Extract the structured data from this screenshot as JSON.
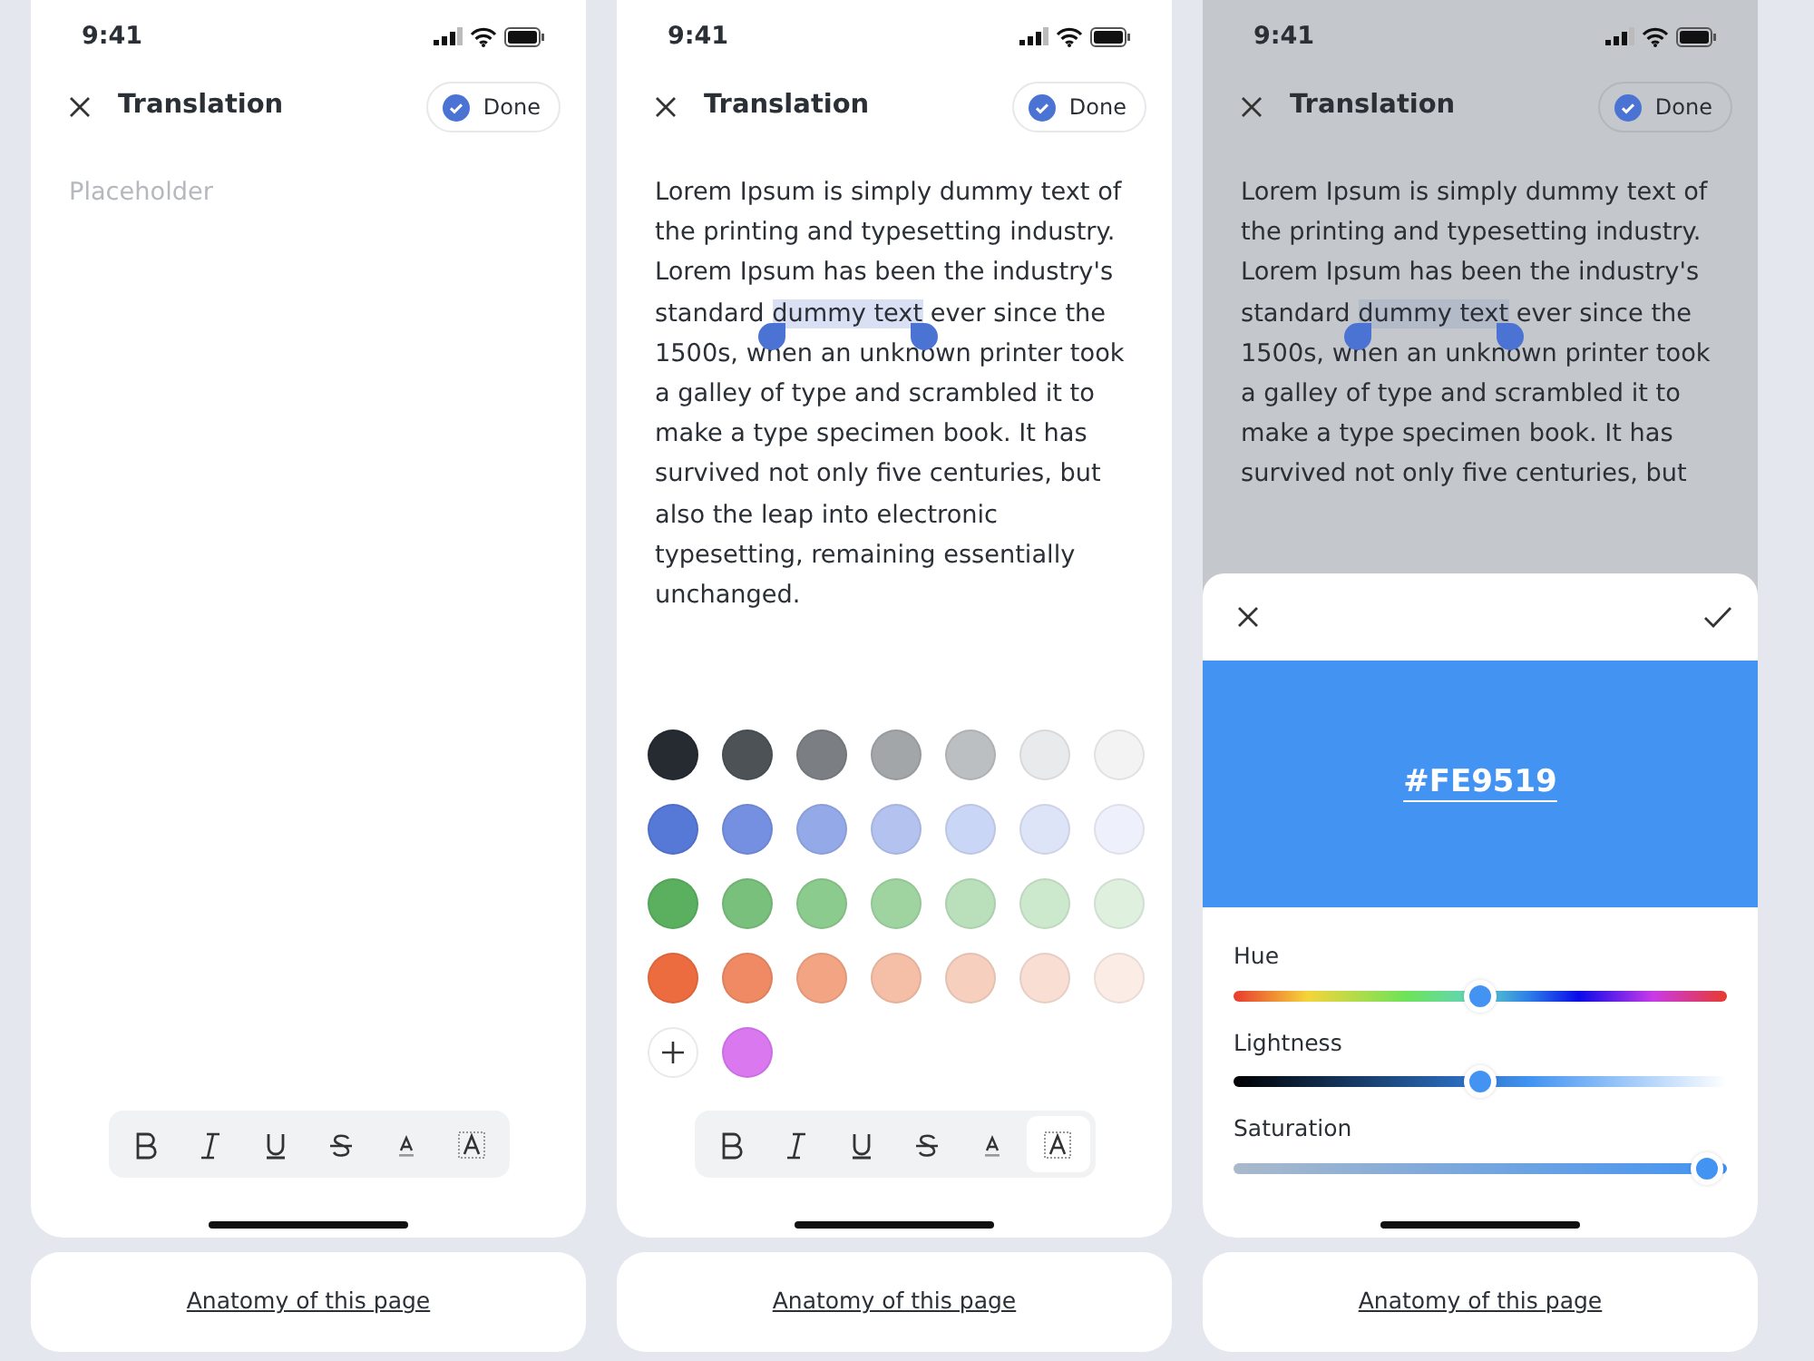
{
  "screens": [
    {
      "status_time": "9:41",
      "title": "Translation",
      "done_label": "Done",
      "dimmed": false,
      "editor": {
        "placeholder": "Placeholder"
      },
      "toolbar": [
        {
          "kind": "bold",
          "selected": false
        },
        {
          "kind": "italic",
          "selected": false
        },
        {
          "kind": "underline",
          "selected": false
        },
        {
          "kind": "strike",
          "selected": false
        },
        {
          "kind": "text-color",
          "selected": false
        },
        {
          "kind": "highlight",
          "selected": false
        }
      ],
      "footer_link": "Anatomy of this page"
    },
    {
      "status_time": "9:41",
      "title": "Translation",
      "done_label": "Done",
      "dimmed": false,
      "editor": {
        "text_before": "Lorem Ipsum is simply dummy text of the printing and typesetting industry. Lorem Ipsum has been the industry's standard ",
        "selection": "dummy text",
        "text_after": " ever since the 1500s, when an unknown printer took a galley of type and scrambled it to make a type specimen book. It has survived not only five centuries, but also the leap into electronic typesetting, remaining essentially unchanged."
      },
      "palette": {
        "colors": [
          {
            "color": "#262b31"
          },
          {
            "color": "#4d5257"
          },
          {
            "color": "#7b7f83"
          },
          {
            "color": "#a3a6a9"
          },
          {
            "color": "#bcbfc2"
          },
          {
            "color": "#e9eaeb"
          },
          {
            "color": "#f3f3f3"
          },
          {
            "color": "#5678d6"
          },
          {
            "color": "#7590e0"
          },
          {
            "color": "#94a9e8"
          },
          {
            "color": "#b3c2ef"
          },
          {
            "color": "#cad6f5"
          },
          {
            "color": "#dde4f8"
          },
          {
            "color": "#eef1fb"
          },
          {
            "color": "#5ab05f"
          },
          {
            "color": "#79c07c"
          },
          {
            "color": "#8ccb8e"
          },
          {
            "color": "#9fd4a1"
          },
          {
            "color": "#badfbb"
          },
          {
            "color": "#cde9cd"
          },
          {
            "color": "#dff0df"
          },
          {
            "color": "#ec6c3f"
          },
          {
            "color": "#ef8a64"
          },
          {
            "color": "#f2a483"
          },
          {
            "color": "#f5bea6"
          },
          {
            "color": "#f7cfbf"
          },
          {
            "color": "#f9ded3"
          },
          {
            "color": "#fbece6"
          }
        ],
        "custom_colors": [
          {
            "color": "#da78f0"
          }
        ]
      },
      "toolbar": [
        {
          "kind": "bold",
          "selected": false
        },
        {
          "kind": "italic",
          "selected": false
        },
        {
          "kind": "underline",
          "selected": false
        },
        {
          "kind": "strike",
          "selected": false
        },
        {
          "kind": "text-color",
          "selected": false
        },
        {
          "kind": "highlight",
          "selected": true
        }
      ],
      "footer_link": "Anatomy of this page"
    },
    {
      "status_time": "9:41",
      "title": "Translation",
      "done_label": "Done",
      "dimmed": true,
      "editor": {
        "text_before": "Lorem Ipsum is simply dummy text of the printing and typesetting industry. Lorem Ipsum has been the industry's standard ",
        "selection": "dummy text",
        "text_after": " ever since the 1500s, when an unknown printer took a galley of type and scrambled it to make a type specimen book. It has survived not only five centuries, but"
      },
      "color_sheet": {
        "hex": "#FE9519",
        "sliders": [
          {
            "label": "Hue",
            "kind": "hue",
            "level": 0.5
          },
          {
            "label": "Lightness",
            "kind": "lightness",
            "level": 0.5
          },
          {
            "label": "Saturation",
            "kind": "saturation",
            "level": 0.96
          }
        ]
      },
      "footer_link": "Anatomy of this page"
    }
  ]
}
